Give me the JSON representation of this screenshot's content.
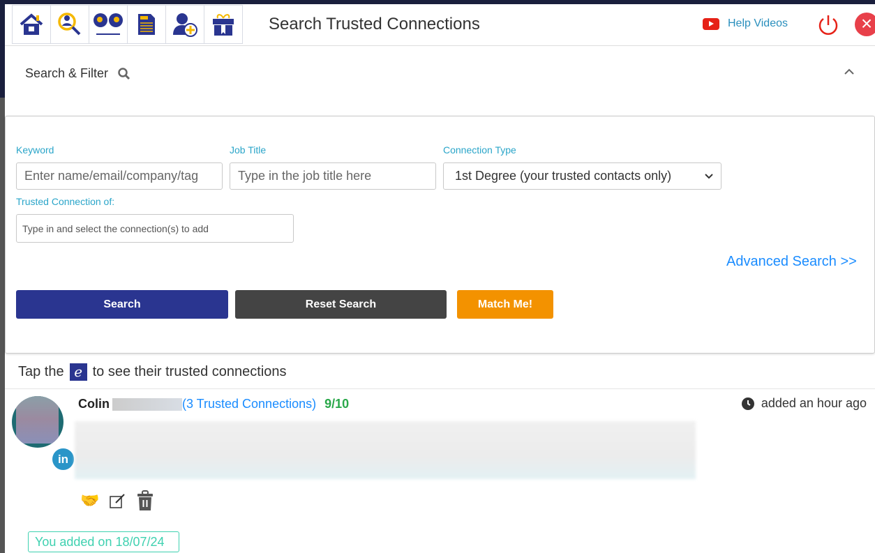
{
  "header": {
    "title": "Search Trusted Connections",
    "help_label": "Help Videos",
    "nav_icons": [
      "home-icon",
      "search-person-icon",
      "mind-exchange-icon",
      "document-icon",
      "add-user-icon",
      "gift-icon"
    ]
  },
  "filter": {
    "title": "Search & Filter",
    "keyword": {
      "label": "Keyword",
      "placeholder": "Enter name/email/company/tag"
    },
    "job_title": {
      "label": "Job Title",
      "placeholder": "Type in the job title here"
    },
    "connection_type": {
      "label": "Connection Type",
      "value": "1st Degree (your trusted contacts only)"
    },
    "trusted_of": {
      "label": "Trusted Connection of:",
      "placeholder": "Type in and select the connection(s) to add"
    },
    "advanced": "Advanced Search >>",
    "search": "Search",
    "reset": "Reset Search",
    "match": "Match Me!"
  },
  "tip": {
    "before": "Tap the",
    "glyph": "e",
    "after": "to see their trusted connections"
  },
  "result": {
    "name": "Colin",
    "connections": "(3 Trusted Connections)",
    "score": "9/10",
    "added_time": "added an hour ago",
    "added_on": "You added on 18/07/24",
    "linkedin": "in"
  },
  "colors": {
    "primary": "#2a3590",
    "reset": "#444444",
    "match": "#f39200",
    "link": "#1a8cff",
    "score": "#2aa84a",
    "label": "#2aa5c9"
  }
}
